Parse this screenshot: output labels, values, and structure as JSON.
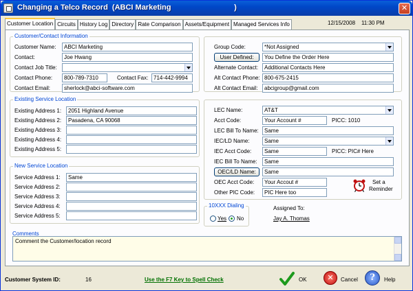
{
  "window": {
    "title": "Changing a Telco Record  (ABCI Marketing                              )",
    "close_glyph": "✕"
  },
  "tabs": [
    {
      "label": "Customer Location",
      "active": true
    },
    {
      "label": "Circuits"
    },
    {
      "label": "History Log"
    },
    {
      "label": "Directory"
    },
    {
      "label": "Rate Comparison"
    },
    {
      "label": "Assets/Equipment"
    },
    {
      "label": "Managed Services Info"
    }
  ],
  "header": {
    "date": "12/15/2008",
    "time": "11:30 PM"
  },
  "customer_contact": {
    "group_label": "Customer/Contact Information",
    "name_label": "Customer Name:",
    "name_value": "ABCI Marketing",
    "contact_label": "Contact:",
    "contact_value": "Joe Hwang",
    "job_title_label": "Contact Job Title:",
    "job_title_value": "",
    "phone_label": "Contact Phone:",
    "phone_value": "800-789-7310",
    "fax_label": "Contact Fax:",
    "fax_value": "714-442-9994",
    "email_label": "Contact Email:",
    "email_value": "sherlock@abci-software.com"
  },
  "group_info": {
    "group_code_label": "Group Code:",
    "group_code_value": "*Not Assigned",
    "user_defined_button": "User Defined:",
    "user_defined_value": "You Define the Order Here",
    "alt_contact_label": "Alternate Contact:",
    "alt_contact_value": "Additional Contacts Here",
    "alt_phone_label": "Alt Contact Phone:",
    "alt_phone_value": "800-675-2415",
    "alt_email_label": "Alt Contact Email:",
    "alt_email_value": "abcigroup@gmail.com"
  },
  "existing_service": {
    "group_label": "Existing Service Location",
    "rows": [
      {
        "label": "Existing Address 1:",
        "value": "2051 Highland Avenue"
      },
      {
        "label": "Existing Address 2:",
        "value": "Pasadena, CA   90068"
      },
      {
        "label": "Existing Address 3:",
        "value": ""
      },
      {
        "label": "Existing Address 4:",
        "value": ""
      },
      {
        "label": "Existing Address 5:",
        "value": ""
      }
    ]
  },
  "new_service": {
    "group_label": "New Service Location",
    "rows": [
      {
        "label": "Service Address 1:",
        "value": "Same"
      },
      {
        "label": "Service Address 2:",
        "value": ""
      },
      {
        "label": "Service Address 3:",
        "value": ""
      },
      {
        "label": "Service Address 4:",
        "value": ""
      },
      {
        "label": "Service Address 5:",
        "value": ""
      }
    ]
  },
  "carrier": {
    "lec_name_label": "LEC Name:",
    "lec_name_value": "AT&T",
    "acct_code_label": "Acct Code:",
    "acct_code_value": "Your Account #",
    "picc_label": "PICC: 1010",
    "lec_bill_label": "LEC Bill To Name:",
    "lec_bill_value": "Same",
    "iec_name_label": "IEC/LD Name:",
    "iec_name_value": "Same",
    "iec_acct_label": "IEC Acct Code:",
    "iec_acct_value": "Same",
    "picc_iec_label": "PICC: PIC# Here",
    "iec_bill_label": "IEC Bill To Name:",
    "iec_bill_value": "Same",
    "oec_button": "OEC/LD Name:",
    "oec_name_value": "Same",
    "oec_acct_label": "OEC Acct Code:",
    "oec_acct_value": "Your Accout #",
    "other_pic_label": "Other PIC Code:",
    "other_pic_value": "PIC Here too",
    "reminder_label_1": "Set a",
    "reminder_label_2": "Reminder"
  },
  "dialing": {
    "group_label": "10XXX Dialing",
    "yes_label": "Yes",
    "no_label": "No",
    "selected": "No"
  },
  "assigned": {
    "label": "Assigned To:",
    "value": "Jay A. Thomas"
  },
  "comments": {
    "group_label": "Comments",
    "text": "Comment the Customer/location record"
  },
  "footer": {
    "system_id_label": "Customer System ID:",
    "system_id_value": "16",
    "spell_check": "Use the F7 Key to Spell Check",
    "ok_label": "OK",
    "cancel_label": "Cancel",
    "help_label": "Help"
  }
}
